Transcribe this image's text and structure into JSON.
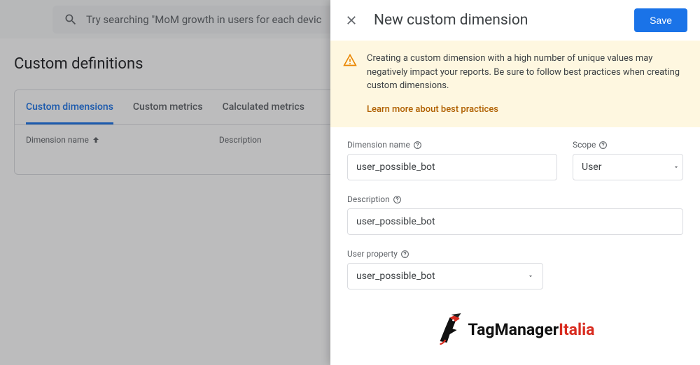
{
  "search": {
    "placeholder": "Try searching \"MoM growth in users for each devic"
  },
  "page": {
    "title": "Custom definitions"
  },
  "tabs": {
    "custom_dimensions": "Custom dimensions",
    "custom_metrics": "Custom metrics",
    "calculated_metrics": "Calculated metrics"
  },
  "table": {
    "col_name": "Dimension name",
    "col_desc": "Description"
  },
  "panel": {
    "title": "New custom dimension",
    "save": "Save",
    "warning_text": "Creating a custom dimension with a high number of unique values may negatively impact your reports. Be sure to follow best practices when creating custom dimensions.",
    "learn_more": "Learn more about best practices",
    "labels": {
      "dimension_name": "Dimension name",
      "scope": "Scope",
      "description": "Description",
      "user_property": "User property"
    },
    "values": {
      "dimension_name": "user_possible_bot",
      "scope": "User",
      "description": "user_possible_bot",
      "user_property": "user_possible_bot"
    }
  },
  "branding": {
    "part1": "TagManager",
    "part2": "Italia"
  }
}
